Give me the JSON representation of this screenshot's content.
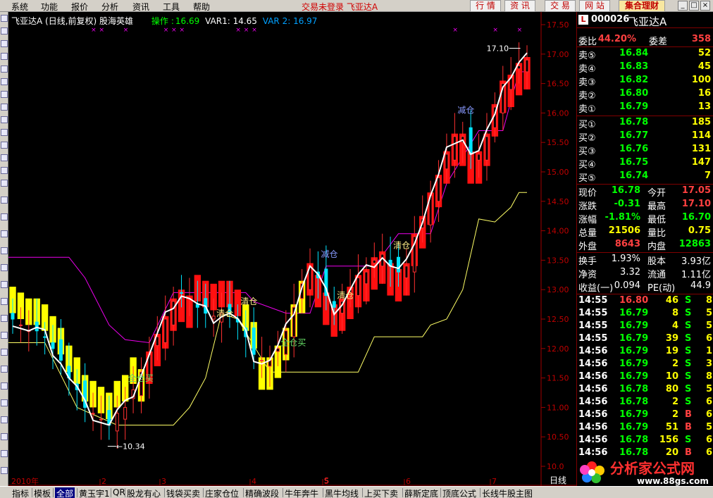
{
  "menu": {
    "items": [
      "系统",
      "功能",
      "报价",
      "分析",
      "资讯",
      "工具",
      "帮助"
    ],
    "notice": "交易未登录 飞亚达A",
    "top_buttons": [
      "行 情",
      "资 讯",
      "交 易",
      "网 站",
      "集合理财"
    ]
  },
  "chart": {
    "title": "飞亚达A (日线,前复权) 股海英雄",
    "indicator_label": "操作",
    "indicator_value": "16.69",
    "var1": "VAR1: 14.65",
    "var2": "VAR 2: 16.97",
    "price_axis": [
      "17.50",
      "17.00",
      "16.50",
      "16.00",
      "15.50",
      "15.00",
      "14.50",
      "14.00",
      "13.50",
      "13.00",
      "12.50",
      "12.00",
      "11.50",
      "11.00",
      "10.50",
      "10.0"
    ],
    "period_label": "日线",
    "x_labels": [
      "2010年",
      "2",
      "3",
      "4",
      "5",
      "6",
      "7"
    ],
    "marker_low": "10.34",
    "marker_high": "17.10",
    "signal_s": "S",
    "annotations": [
      {
        "text": "全仓买",
        "color": "#66dd66"
      },
      {
        "text": "清仓",
        "color": "#ffee88"
      },
      {
        "text": "清仓",
        "color": "#ffee88"
      },
      {
        "text": "全仓买",
        "color": "#66dd66"
      },
      {
        "text": "减仓",
        "color": "#8899ff"
      },
      {
        "text": "清仓",
        "color": "#ffee88"
      },
      {
        "text": "清仓",
        "color": "#ffee88"
      },
      {
        "text": "减仓",
        "color": "#8899ff"
      }
    ]
  },
  "chart_data": {
    "type": "candlestick",
    "ylim": [
      10.0,
      17.5
    ],
    "ticks": [
      "17.50",
      "17.00",
      "16.50",
      "16.00",
      "15.50",
      "15.00",
      "14.50",
      "14.00",
      "13.50",
      "13.00",
      "12.50",
      "12.00",
      "11.50",
      "11.00",
      "10.50",
      "10.0"
    ],
    "low_point": 10.34,
    "high_point": 17.1,
    "close_series_approx": [
      12.5,
      12.4,
      12.3,
      12.3,
      12.2,
      12.0,
      11.8,
      11.5,
      11.3,
      11.0,
      10.9,
      10.8,
      10.7,
      10.9,
      11.0,
      11.3,
      11.6,
      11.9,
      12.2,
      12.5,
      12.8,
      12.95,
      12.85,
      12.7,
      12.6,
      12.55,
      12.6,
      12.6,
      12.45,
      12.2,
      11.9,
      11.8,
      11.8,
      12.0,
      12.3,
      12.7,
      13.1,
      13.4,
      13.2,
      12.9,
      12.7,
      12.8,
      13.0,
      13.2,
      13.3,
      13.5,
      13.6,
      13.4,
      13.3,
      13.4,
      13.9,
      14.2,
      14.6,
      14.9,
      15.3,
      15.6,
      15.6,
      15.3,
      15.3,
      15.6,
      16.1,
      16.5,
      16.6,
      16.8,
      16.9
    ]
  },
  "quote": {
    "code": "000026",
    "name": "飞亚达A",
    "wb_label": "委比",
    "wb_value": "44.20%",
    "wc_label": "委差",
    "wc_value": "358",
    "sell": [
      {
        "label": "卖⑤",
        "price": "16.84",
        "vol": "52"
      },
      {
        "label": "卖④",
        "price": "16.83",
        "vol": "45"
      },
      {
        "label": "卖③",
        "price": "16.82",
        "vol": "100"
      },
      {
        "label": "卖②",
        "price": "16.80",
        "vol": "16"
      },
      {
        "label": "卖①",
        "price": "16.79",
        "vol": "13"
      }
    ],
    "buy": [
      {
        "label": "买①",
        "price": "16.78",
        "vol": "185"
      },
      {
        "label": "买②",
        "price": "16.77",
        "vol": "114"
      },
      {
        "label": "买③",
        "price": "16.76",
        "vol": "131"
      },
      {
        "label": "买④",
        "price": "16.75",
        "vol": "147"
      },
      {
        "label": "买⑤",
        "price": "16.74",
        "vol": "7"
      }
    ],
    "stats": [
      {
        "l1": "现价",
        "v1": "16.78",
        "c1": "#00ff00",
        "l2": "今开",
        "v2": "17.05",
        "c2": "#ff4040"
      },
      {
        "l1": "涨跌",
        "v1": "-0.31",
        "c1": "#00ff00",
        "l2": "最高",
        "v2": "17.10",
        "c2": "#ff4040"
      },
      {
        "l1": "涨幅",
        "v1": "-1.81%",
        "c1": "#00ff00",
        "l2": "最低",
        "v2": "16.70",
        "c2": "#00ff00"
      },
      {
        "l1": "总量",
        "v1": "21506",
        "c1": "#ffff00",
        "l2": "量比",
        "v2": "0.75",
        "c2": "#ffff00"
      },
      {
        "l1": "外盘",
        "v1": "8643",
        "c1": "#ff4040",
        "l2": "内盘",
        "v2": "12863",
        "c2": "#00ff00"
      }
    ],
    "stats2": [
      {
        "l1": "换手",
        "v1": "1.93%",
        "l2": "股本",
        "v2": "3.93亿"
      },
      {
        "l1": "净资",
        "v1": "3.32",
        "l2": "流通",
        "v2": "1.11亿"
      },
      {
        "l1": "收益(一)",
        "v1": "0.094",
        "l2": "PE(动)",
        "v2": "44.9"
      }
    ],
    "ticks": [
      {
        "t": "14:55",
        "p": "16.80",
        "v": "46",
        "s": "S"
      },
      {
        "t": "14:55",
        "p": "16.79",
        "v": "8",
        "s": "S"
      },
      {
        "t": "14:55",
        "p": "16.79",
        "v": "4",
        "s": "S"
      },
      {
        "t": "14:55",
        "p": "16.79",
        "v": "39",
        "s": "S"
      },
      {
        "t": "14:56",
        "p": "16.79",
        "v": "19",
        "s": "S"
      },
      {
        "t": "14:56",
        "p": "16.79",
        "v": "2",
        "s": "S"
      },
      {
        "t": "14:56",
        "p": "16.79",
        "v": "10",
        "s": "S"
      },
      {
        "t": "14:56",
        "p": "16.78",
        "v": "80",
        "s": "S"
      },
      {
        "t": "14:56",
        "p": "16.78",
        "v": "2",
        "s": "S"
      },
      {
        "t": "14:56",
        "p": "16.79",
        "v": "2",
        "s": "B"
      },
      {
        "t": "14:56",
        "p": "16.79",
        "v": "51",
        "s": "B"
      },
      {
        "t": "14:56",
        "p": "16.78",
        "v": "156",
        "s": "S"
      },
      {
        "t": "14:56",
        "p": "16.78",
        "v": "20",
        "s": "B"
      }
    ],
    "tick_trailing": [
      "8",
      "5",
      "5",
      "6",
      "1",
      "3",
      "8",
      "5",
      "6",
      "6",
      "5",
      "6",
      "6"
    ]
  },
  "tabs": [
    "指标",
    "模板",
    "全部",
    "黄玉宇1",
    "QR",
    "股龙有心",
    "钱袋买卖",
    "庄家仓位",
    "精确波段",
    "牛年奔牛",
    "黑牛均线",
    "上买下卖",
    "薛斯定底",
    "顶底公式",
    "长线牛股主图"
  ],
  "watermark": {
    "title": "分析家公式网",
    "url": "www.88gs.com"
  },
  "colors": {
    "up": "#ff3030",
    "down": "#00e5ff",
    "ma": "#ffffff",
    "band": "#ffff00",
    "stop": "#ee00ee",
    "support": "#ffff66"
  }
}
